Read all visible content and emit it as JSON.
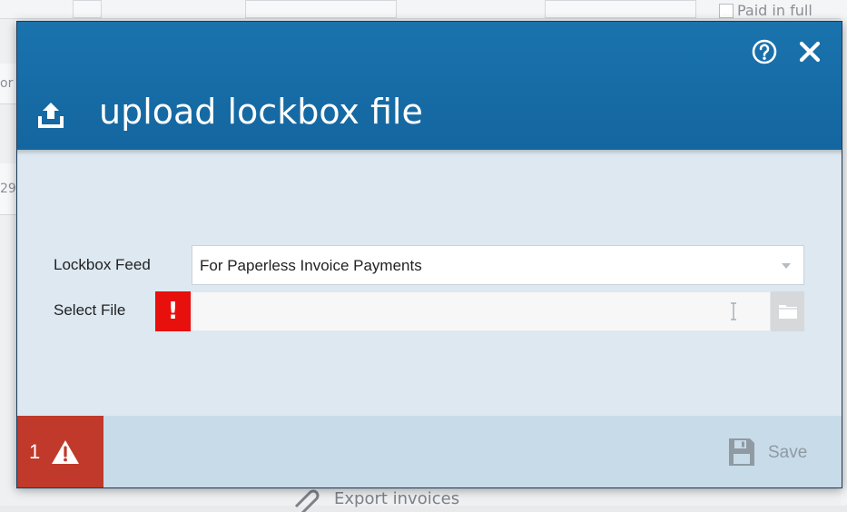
{
  "background": {
    "paid_label": "Paid in full",
    "left_fragment_1": "or",
    "left_fragment_2": "29",
    "export_label": "Export invoices"
  },
  "dialog": {
    "title": "upload lockbox file",
    "icons": {
      "title": "upload-icon",
      "help": "help-circle-icon",
      "close": "close-icon"
    },
    "fields": {
      "feed_label": "Lockbox Feed",
      "feed_value": "For Paperless Invoice Payments",
      "file_label": "Select File",
      "file_value": "",
      "file_error_mark": "!"
    },
    "footer": {
      "warning_count": "1",
      "save_label": "Save"
    },
    "colors": {
      "header": "#1a73ad",
      "body": "#dde8f1",
      "footer": "#c8dbe8",
      "warning": "#c0392b",
      "error": "#e8100c"
    }
  }
}
